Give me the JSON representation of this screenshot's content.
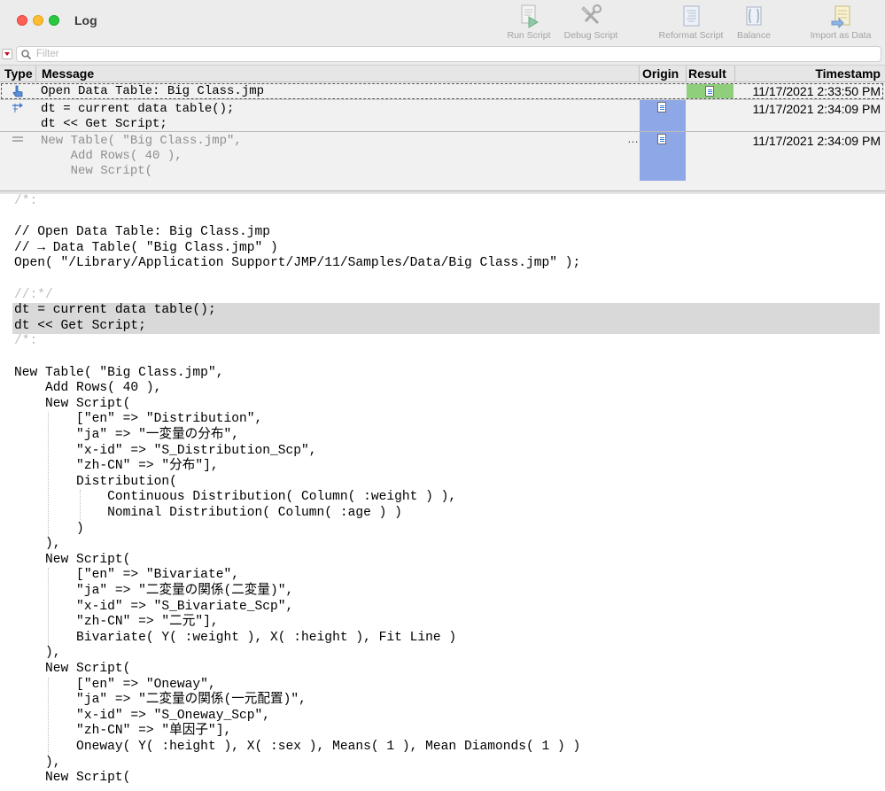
{
  "window": {
    "title": "Log"
  },
  "toolbar": [
    {
      "label": "Run Script",
      "icon": "run-script-icon"
    },
    {
      "label": "Debug Script",
      "icon": "debug-script-icon"
    },
    {
      "label": "Reformat Script",
      "icon": "reformat-script-icon"
    },
    {
      "label": "Balance",
      "icon": "balance-icon"
    },
    {
      "label": "Import as Data",
      "icon": "import-as-data-icon"
    }
  ],
  "filter": {
    "placeholder": "Filter",
    "value": ""
  },
  "columns": {
    "type": "Type",
    "message": "Message",
    "origin": "Origin",
    "result": "Result",
    "timestamp": "Timestamp"
  },
  "rows": [
    {
      "type_icon": "open-hand-icon",
      "message": [
        "Open Data Table: Big Class.jmp"
      ],
      "timestamp": "11/17/2021 2:33:50 PM",
      "result_icon": "data-table-icon",
      "origin_icon": ""
    },
    {
      "type_icon": "script-run-icon",
      "message": [
        "dt = current data table();",
        "dt << Get Script;"
      ],
      "timestamp": "11/17/2021 2:34:09 PM",
      "result_icon": "",
      "origin_icon": "script-doc-icon"
    },
    {
      "type_icon": "output-lines-icon",
      "message": [
        "New Table( \"Big Class.jmp\",",
        "    Add Rows( 40 ),",
        "    New Script("
      ],
      "timestamp": "11/17/2021 2:34:09 PM",
      "result_icon": "",
      "origin_icon": "script-doc-icon",
      "truncated_marker": "…"
    }
  ],
  "editor_lines": [
    {
      "text": "/*:",
      "style": "comment"
    },
    {
      "text": "",
      "style": "code"
    },
    {
      "text": "// Open Data Table: Big Class.jmp",
      "style": "code"
    },
    {
      "text": "// → Data Table( \"Big Class.jmp\" )",
      "style": "code"
    },
    {
      "text": "Open( \"/Library/Application Support/JMP/11/Samples/Data/Big Class.jmp\" );",
      "style": "code"
    },
    {
      "text": "",
      "style": "code"
    },
    {
      "text": "//:*/",
      "style": "comment"
    },
    {
      "text": "dt = current data table();",
      "style": "highlight"
    },
    {
      "text": "dt << Get Script;",
      "style": "highlight"
    },
    {
      "text": "/*:",
      "style": "comment"
    },
    {
      "text": "",
      "style": "code"
    },
    {
      "text": "New Table( \"Big Class.jmp\",",
      "style": "code"
    },
    {
      "text": "    Add Rows( 40 ),",
      "style": "code"
    },
    {
      "text": "    New Script(",
      "style": "code"
    },
    {
      "text": "        [\"en\" => \"Distribution\",",
      "style": "code"
    },
    {
      "text": "        \"ja\" => \"一変量の分布\",",
      "style": "code"
    },
    {
      "text": "        \"x-id\" => \"S_Distribution_Scp\",",
      "style": "code"
    },
    {
      "text": "        \"zh-CN\" => \"分布\"],",
      "style": "code"
    },
    {
      "text": "        Distribution(",
      "style": "code"
    },
    {
      "text": "            Continuous Distribution( Column( :weight ) ),",
      "style": "code"
    },
    {
      "text": "            Nominal Distribution( Column( :age ) )",
      "style": "code"
    },
    {
      "text": "        )",
      "style": "code"
    },
    {
      "text": "    ),",
      "style": "code"
    },
    {
      "text": "    New Script(",
      "style": "code"
    },
    {
      "text": "        [\"en\" => \"Bivariate\",",
      "style": "code"
    },
    {
      "text": "        \"ja\" => \"二変量の関係(二変量)\",",
      "style": "code"
    },
    {
      "text": "        \"x-id\" => \"S_Bivariate_Scp\",",
      "style": "code"
    },
    {
      "text": "        \"zh-CN\" => \"二元\"],",
      "style": "code"
    },
    {
      "text": "        Bivariate( Y( :weight ), X( :height ), Fit Line )",
      "style": "code"
    },
    {
      "text": "    ),",
      "style": "code"
    },
    {
      "text": "    New Script(",
      "style": "code"
    },
    {
      "text": "        [\"en\" => \"Oneway\",",
      "style": "code"
    },
    {
      "text": "        \"ja\" => \"二変量の関係(一元配置)\",",
      "style": "code"
    },
    {
      "text": "        \"x-id\" => \"S_Oneway_Scp\",",
      "style": "code"
    },
    {
      "text": "        \"zh-CN\" => \"单因子\"],",
      "style": "code"
    },
    {
      "text": "        Oneway( Y( :height ), X( :sex ), Means( 1 ), Mean Diamonds( 1 ) )",
      "style": "code"
    },
    {
      "text": "    ),",
      "style": "code"
    },
    {
      "text": "    New Script(",
      "style": "code"
    }
  ],
  "colors": {
    "origin_fill": "#8ea7e6",
    "result_fill": "#8fcf7b",
    "line_highlight": "#d9d9d9",
    "comment_text": "#bcbcbc"
  }
}
